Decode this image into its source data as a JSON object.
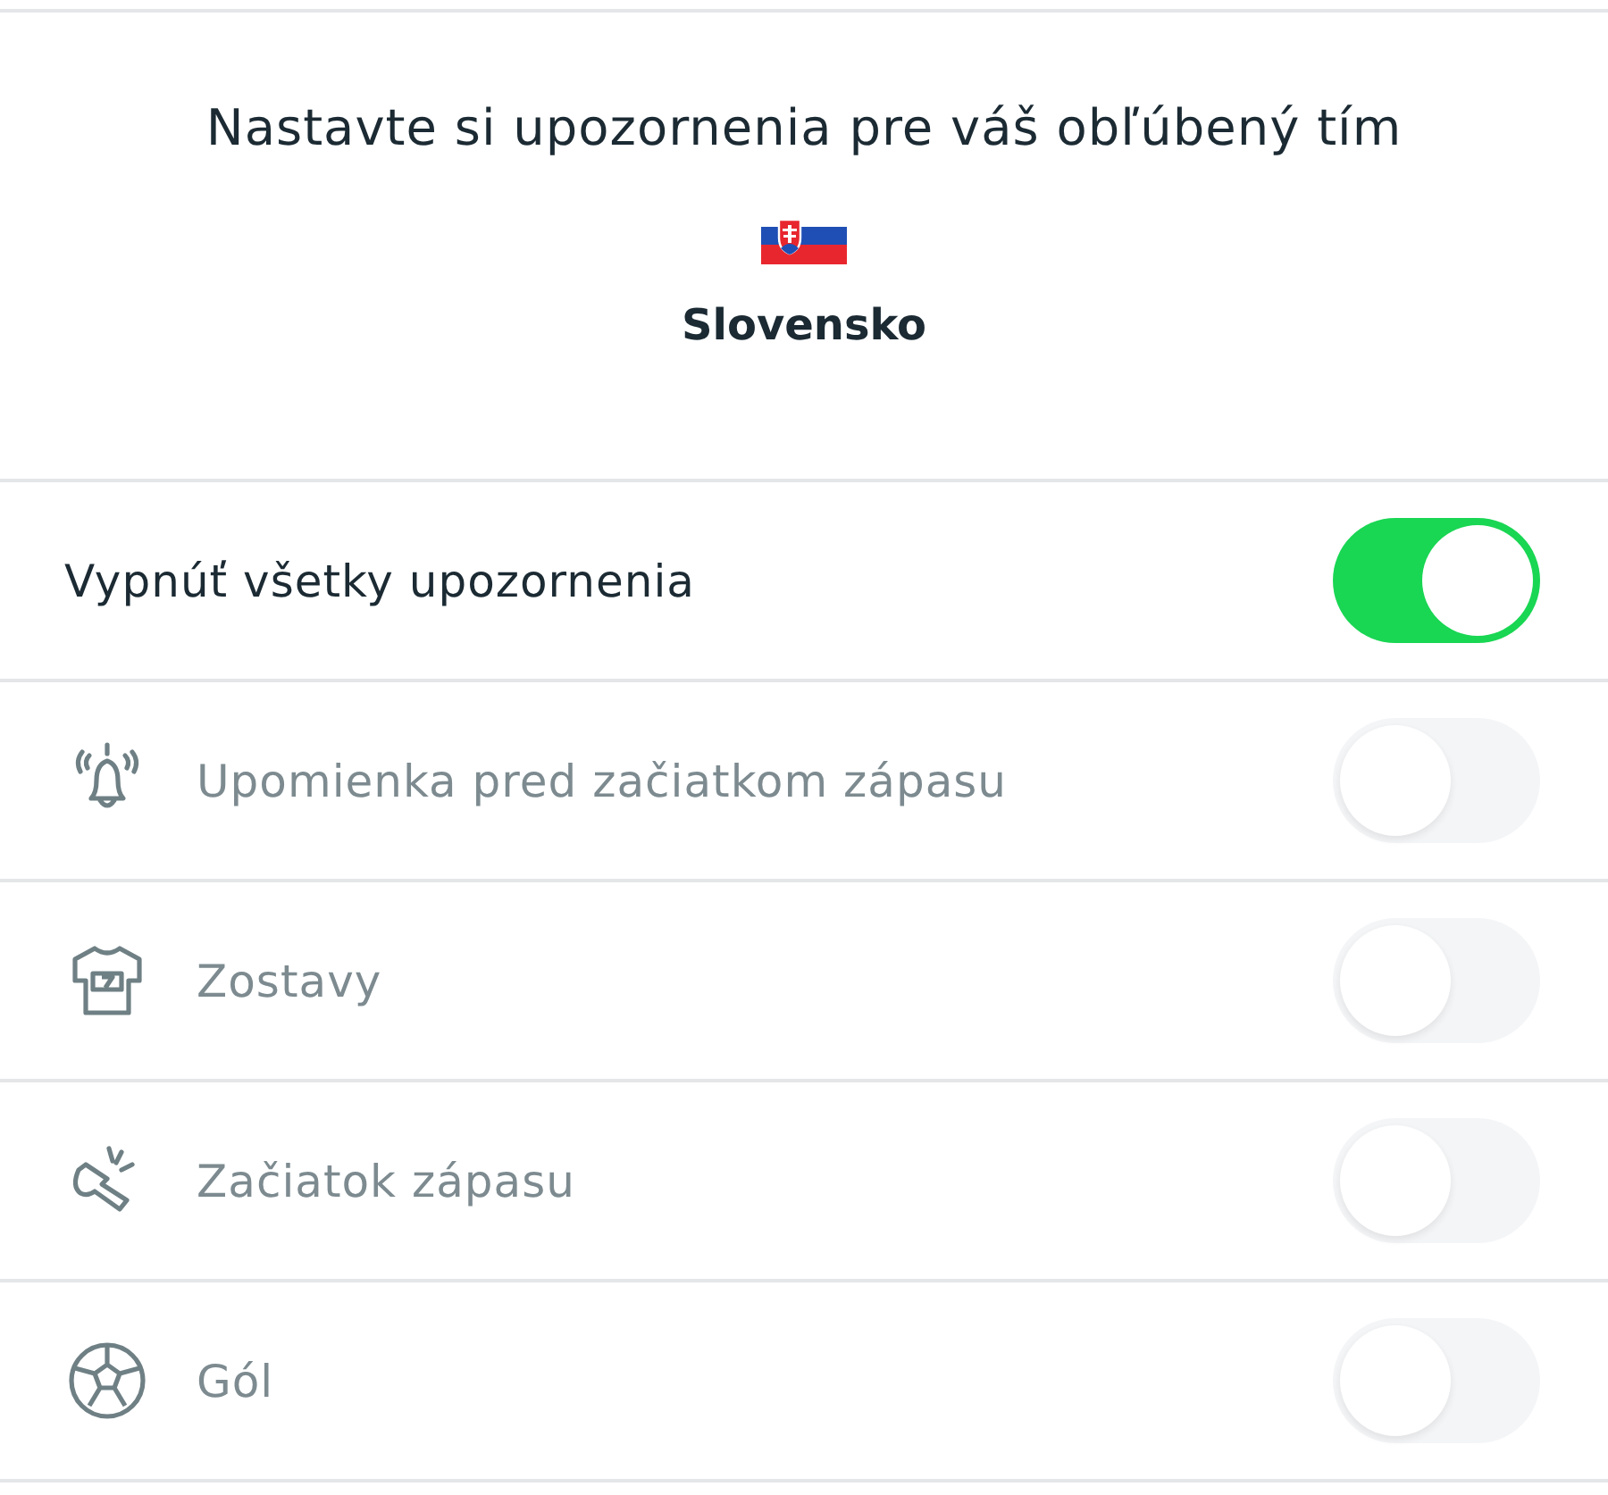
{
  "header": {
    "title": "Nastavte si upozornenia pre váš obľúbený tím",
    "team": "Slovensko"
  },
  "rows": [
    {
      "kind": "master",
      "label": "Vypnúť všetky upozornenia",
      "on": true,
      "disabled": false
    },
    {
      "kind": "bell",
      "label": "Upomienka pred začiatkom zápasu",
      "on": false,
      "disabled": true
    },
    {
      "kind": "jersey",
      "label": "Zostavy",
      "on": false,
      "disabled": true
    },
    {
      "kind": "whistle",
      "label": "Začiatok zápasu",
      "on": false,
      "disabled": true
    },
    {
      "kind": "ball",
      "label": "Gól",
      "on": false,
      "disabled": true
    }
  ]
}
